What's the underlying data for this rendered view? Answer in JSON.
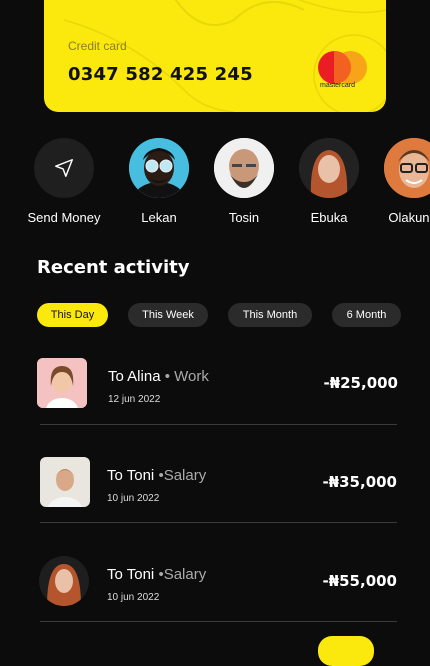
{
  "card": {
    "label": "Credit card",
    "number": "0347 582 425 245",
    "brand": "mastercard"
  },
  "contacts": [
    {
      "name": "Send Money",
      "icon": "send-icon"
    },
    {
      "name": "Lekan"
    },
    {
      "name": "Tosin"
    },
    {
      "name": "Ebuka"
    },
    {
      "name": "Olakunle"
    }
  ],
  "activity": {
    "title": "Recent activity",
    "filters": [
      "This Day",
      "This Week",
      "This Month",
      "6 Month"
    ],
    "active_filter": "This Day",
    "transactions": [
      {
        "name": "To Alina",
        "tag": "• Work",
        "date": "12 jun 2022",
        "amount": "-₦25,000"
      },
      {
        "name": "To Toni",
        "tag": "•Salary",
        "date": "10 jun 2022",
        "amount": "-₦35,000"
      },
      {
        "name": "To Toni",
        "tag": "•Salary",
        "date": "10 jun 2022",
        "amount": "-₦55,000"
      }
    ]
  },
  "colors": {
    "accent": "#fbe80c",
    "background": "#0c0c0c",
    "chip": "#2b2b2b"
  }
}
